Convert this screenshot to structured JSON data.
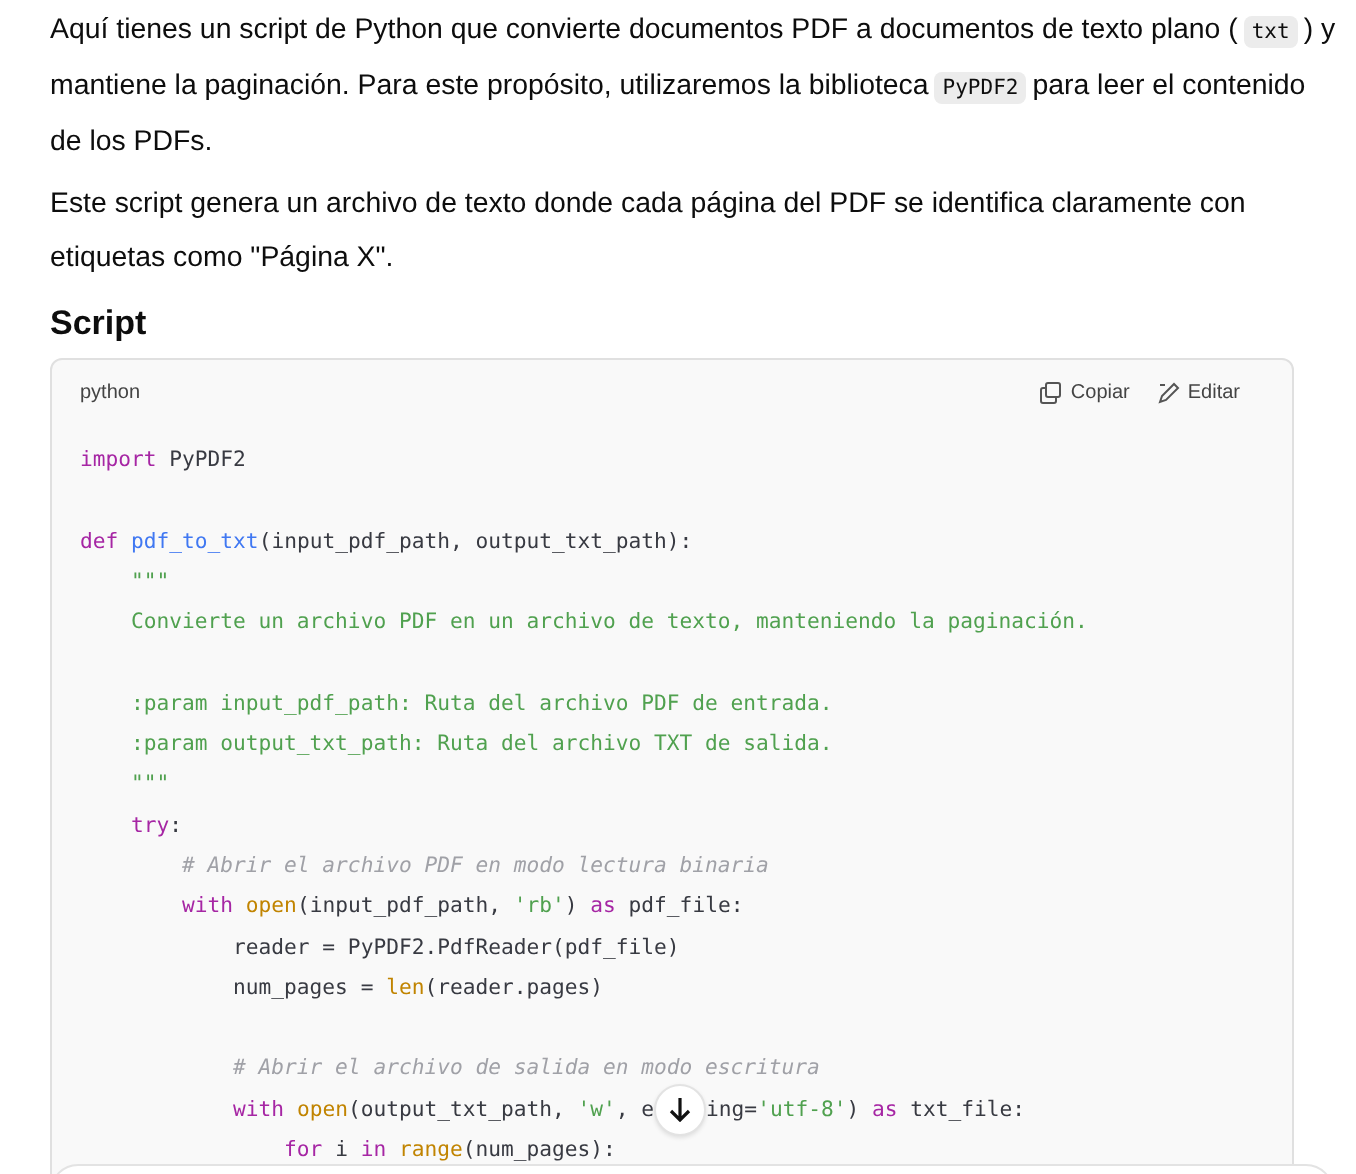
{
  "intro": [
    [
      {
        "kind": "text",
        "text": "Aquí tienes un script de Python que convierte documentos PDF a documentos de texto plano ("
      },
      {
        "kind": "code",
        "text": "txt"
      },
      {
        "kind": "text",
        "text": ") y mantiene la paginación. Para este propósito, utilizaremos la biblioteca"
      },
      {
        "kind": "code",
        "text": "PyPDF2"
      },
      {
        "kind": "text",
        "text": "para leer el contenido de los PDFs."
      }
    ],
    [
      {
        "kind": "text",
        "text": "Este script genera un archivo de texto donde cada página del PDF se identifica claramente con etiquetas como \"Página X\"."
      }
    ]
  ],
  "heading": "Script",
  "code_block": {
    "language": "python",
    "copy_label": "Copiar",
    "edit_label": "Editar",
    "lines": [
      {
        "kind": "code",
        "tokens": [
          {
            "kind": "keyword",
            "text": "import"
          },
          {
            "kind": "plain",
            "text": " PyPDF2"
          }
        ]
      },
      {
        "kind": "blank"
      },
      {
        "kind": "code",
        "tokens": [
          {
            "kind": "keyword",
            "text": "def"
          },
          {
            "kind": "function",
            "text": " pdf_to_txt"
          },
          {
            "kind": "plain",
            "text": "(input_pdf_path, output_txt_path):"
          }
        ]
      },
      {
        "kind": "code",
        "tokens": [
          {
            "kind": "string",
            "text": "    \"\"\""
          }
        ]
      },
      {
        "kind": "code",
        "tokens": [
          {
            "kind": "string",
            "text": "    Convierte un archivo PDF en un archivo de texto, manteniendo la paginación."
          }
        ]
      },
      {
        "kind": "blank"
      },
      {
        "kind": "code",
        "tokens": [
          {
            "kind": "string",
            "text": "    :param input_pdf_path: Ruta del archivo PDF de entrada."
          }
        ]
      },
      {
        "kind": "code",
        "tokens": [
          {
            "kind": "string",
            "text": "    :param output_txt_path: Ruta del archivo TXT de salida."
          }
        ]
      },
      {
        "kind": "code",
        "tokens": [
          {
            "kind": "string",
            "text": "    \"\"\""
          }
        ]
      },
      {
        "kind": "code",
        "tokens": [
          {
            "kind": "keyword",
            "text": "    try"
          },
          {
            "kind": "plain",
            "text": ":"
          }
        ]
      },
      {
        "kind": "code",
        "tokens": [
          {
            "kind": "comment",
            "text": "        # Abrir el archivo PDF en modo lectura binaria"
          }
        ]
      },
      {
        "kind": "code",
        "tokens": [
          {
            "kind": "keyword",
            "text": "        with"
          },
          {
            "kind": "builtin",
            "text": " open"
          },
          {
            "kind": "plain",
            "text": "(input_pdf_path, "
          },
          {
            "kind": "string",
            "text": "'rb'"
          },
          {
            "kind": "plain",
            "text": ") "
          },
          {
            "kind": "keyword",
            "text": "as"
          },
          {
            "kind": "plain",
            "text": " pdf_file:"
          }
        ]
      },
      {
        "kind": "code",
        "tokens": [
          {
            "kind": "plain",
            "text": "            reader = PyPDF2.PdfReader(pdf_file)"
          }
        ]
      },
      {
        "kind": "code",
        "tokens": [
          {
            "kind": "plain",
            "text": "            num_pages = "
          },
          {
            "kind": "builtin",
            "text": "len"
          },
          {
            "kind": "plain",
            "text": "(reader.pages)"
          }
        ]
      },
      {
        "kind": "blank"
      },
      {
        "kind": "code",
        "tokens": [
          {
            "kind": "comment",
            "text": "            # Abrir el archivo de salida en modo escritura"
          }
        ]
      },
      {
        "kind": "code",
        "tokens": [
          {
            "kind": "keyword",
            "text": "            with"
          },
          {
            "kind": "builtin",
            "text": " open"
          },
          {
            "kind": "plain",
            "text": "(output_txt_path, "
          },
          {
            "kind": "string",
            "text": "'w'"
          },
          {
            "kind": "plain",
            "text": ", e"
          }
        ],
        "tokens_after": [
          {
            "kind": "plain",
            "text": "ing="
          },
          {
            "kind": "string",
            "text": "'utf-8'"
          },
          {
            "kind": "plain",
            "text": ") "
          },
          {
            "kind": "keyword",
            "text": "as"
          },
          {
            "kind": "plain",
            "text": " txt_file:"
          }
        ]
      },
      {
        "kind": "code",
        "tokens": [
          {
            "kind": "keyword",
            "text": "                for"
          },
          {
            "kind": "plain",
            "text": " i "
          },
          {
            "kind": "keyword",
            "text": "in"
          },
          {
            "kind": "builtin",
            "text": " range"
          },
          {
            "kind": "plain",
            "text": "(num_pages):"
          }
        ]
      }
    ]
  }
}
